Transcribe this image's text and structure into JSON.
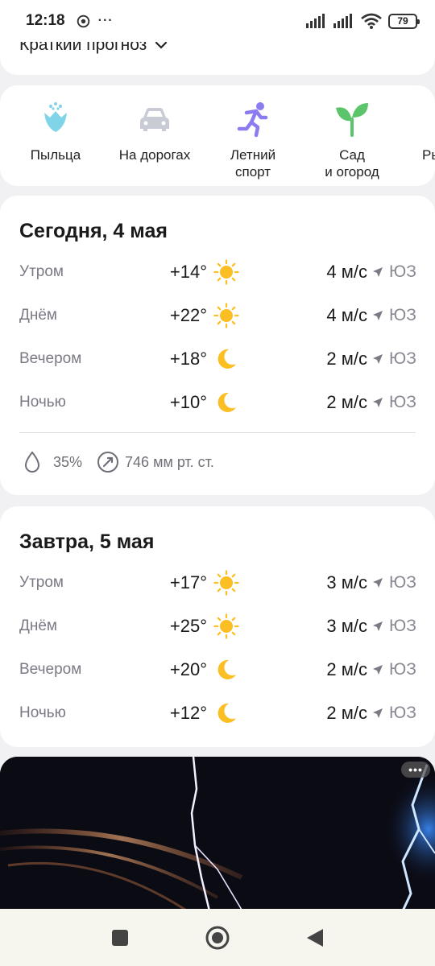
{
  "status": {
    "time": "12:18",
    "dots": "···",
    "battery": "79"
  },
  "summary": {
    "label": "Краткий прогноз"
  },
  "categories": [
    {
      "label": "Пыльца",
      "icon": "flower-icon"
    },
    {
      "label": "На дорогах",
      "icon": "car-icon"
    },
    {
      "label": "Летний спорт",
      "icon": "runner-icon"
    },
    {
      "label": "Сад и огород",
      "icon": "sprout-icon"
    },
    {
      "label": "Ры",
      "icon": "fish-icon"
    }
  ],
  "days": [
    {
      "title": "Сегодня, 4 мая",
      "rows": [
        {
          "part": "Утром",
          "temp": "+14°",
          "icon": "sun-icon",
          "wind": "4 м/с",
          "dir": "ЮЗ"
        },
        {
          "part": "Днём",
          "temp": "+22°",
          "icon": "sun-icon",
          "wind": "4 м/с",
          "dir": "ЮЗ"
        },
        {
          "part": "Вечером",
          "temp": "+18°",
          "icon": "moon-icon",
          "wind": "2 м/с",
          "dir": "ЮЗ"
        },
        {
          "part": "Ночью",
          "temp": "+10°",
          "icon": "moon-icon",
          "wind": "2 м/с",
          "dir": "ЮЗ"
        }
      ],
      "humidity": "35%",
      "pressure": "746 мм рт. ст."
    },
    {
      "title": "Завтра, 5 мая",
      "rows": [
        {
          "part": "Утром",
          "temp": "+17°",
          "icon": "sun-icon",
          "wind": "3 м/с",
          "dir": "ЮЗ"
        },
        {
          "part": "Днём",
          "temp": "+25°",
          "icon": "sun-icon",
          "wind": "3 м/с",
          "dir": "ЮЗ"
        },
        {
          "part": "Вечером",
          "temp": "+20°",
          "icon": "moon-icon",
          "wind": "2 м/с",
          "dir": "ЮЗ"
        },
        {
          "part": "Ночью",
          "temp": "+12°",
          "icon": "moon-icon",
          "wind": "2 м/с",
          "dir": "ЮЗ"
        }
      ]
    }
  ],
  "photo": {
    "more_label": "•••"
  },
  "colors": {
    "sun": "#fbbf24",
    "accent_purple": "#8b7cf0",
    "sprout": "#5cc46a",
    "flower": "#7fd4e8"
  }
}
